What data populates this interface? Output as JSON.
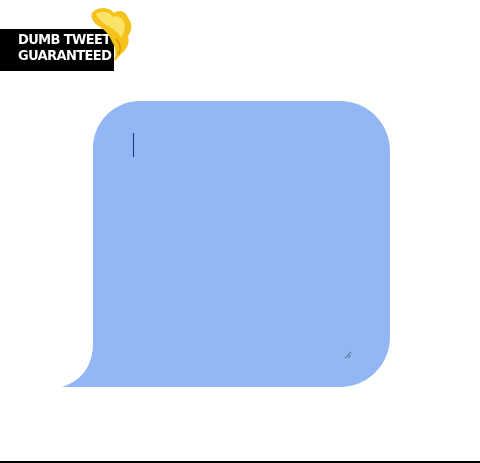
{
  "logo": {
    "line1": "DUMB TWEET",
    "line2": "GUARANTEED",
    "icon": "hair-tuft-icon"
  },
  "colors": {
    "bubble": "#92b7f4",
    "logo_bg": "#000000",
    "logo_text": "#ffffff",
    "hair": "#f5c51b",
    "caret": "#12337a"
  },
  "tweet": {
    "value": "",
    "placeholder": ""
  }
}
